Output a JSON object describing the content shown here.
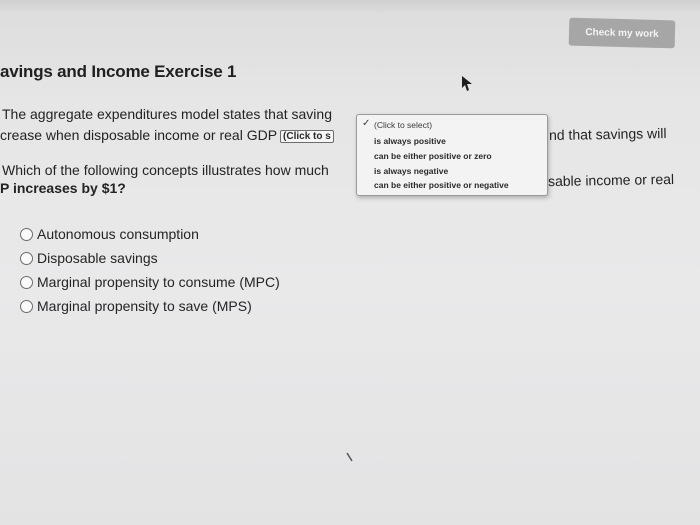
{
  "header": {
    "check_button_label": "Check my work",
    "title": "avings and Income Exercise 1"
  },
  "question1": {
    "line1_start": "The aggregate expenditures model states that saving",
    "line1_end": "nd that savings will",
    "line2_start": "crease when disposable income or real GDP",
    "select_label": "(Click to s"
  },
  "question2": {
    "line1_start": "Which of the following concepts illustrates how much",
    "line1_end": "sable income or real",
    "line2": "P increases by $1?"
  },
  "dropdown": {
    "items": [
      "(Click to select)",
      "is always positive",
      "can be either positive or zero",
      "is always negative",
      "can be either positive or negative"
    ]
  },
  "options": [
    "Autonomous consumption",
    "Disposable savings",
    "Marginal propensity to consume (MPC)",
    "Marginal propensity to save (MPS)"
  ]
}
